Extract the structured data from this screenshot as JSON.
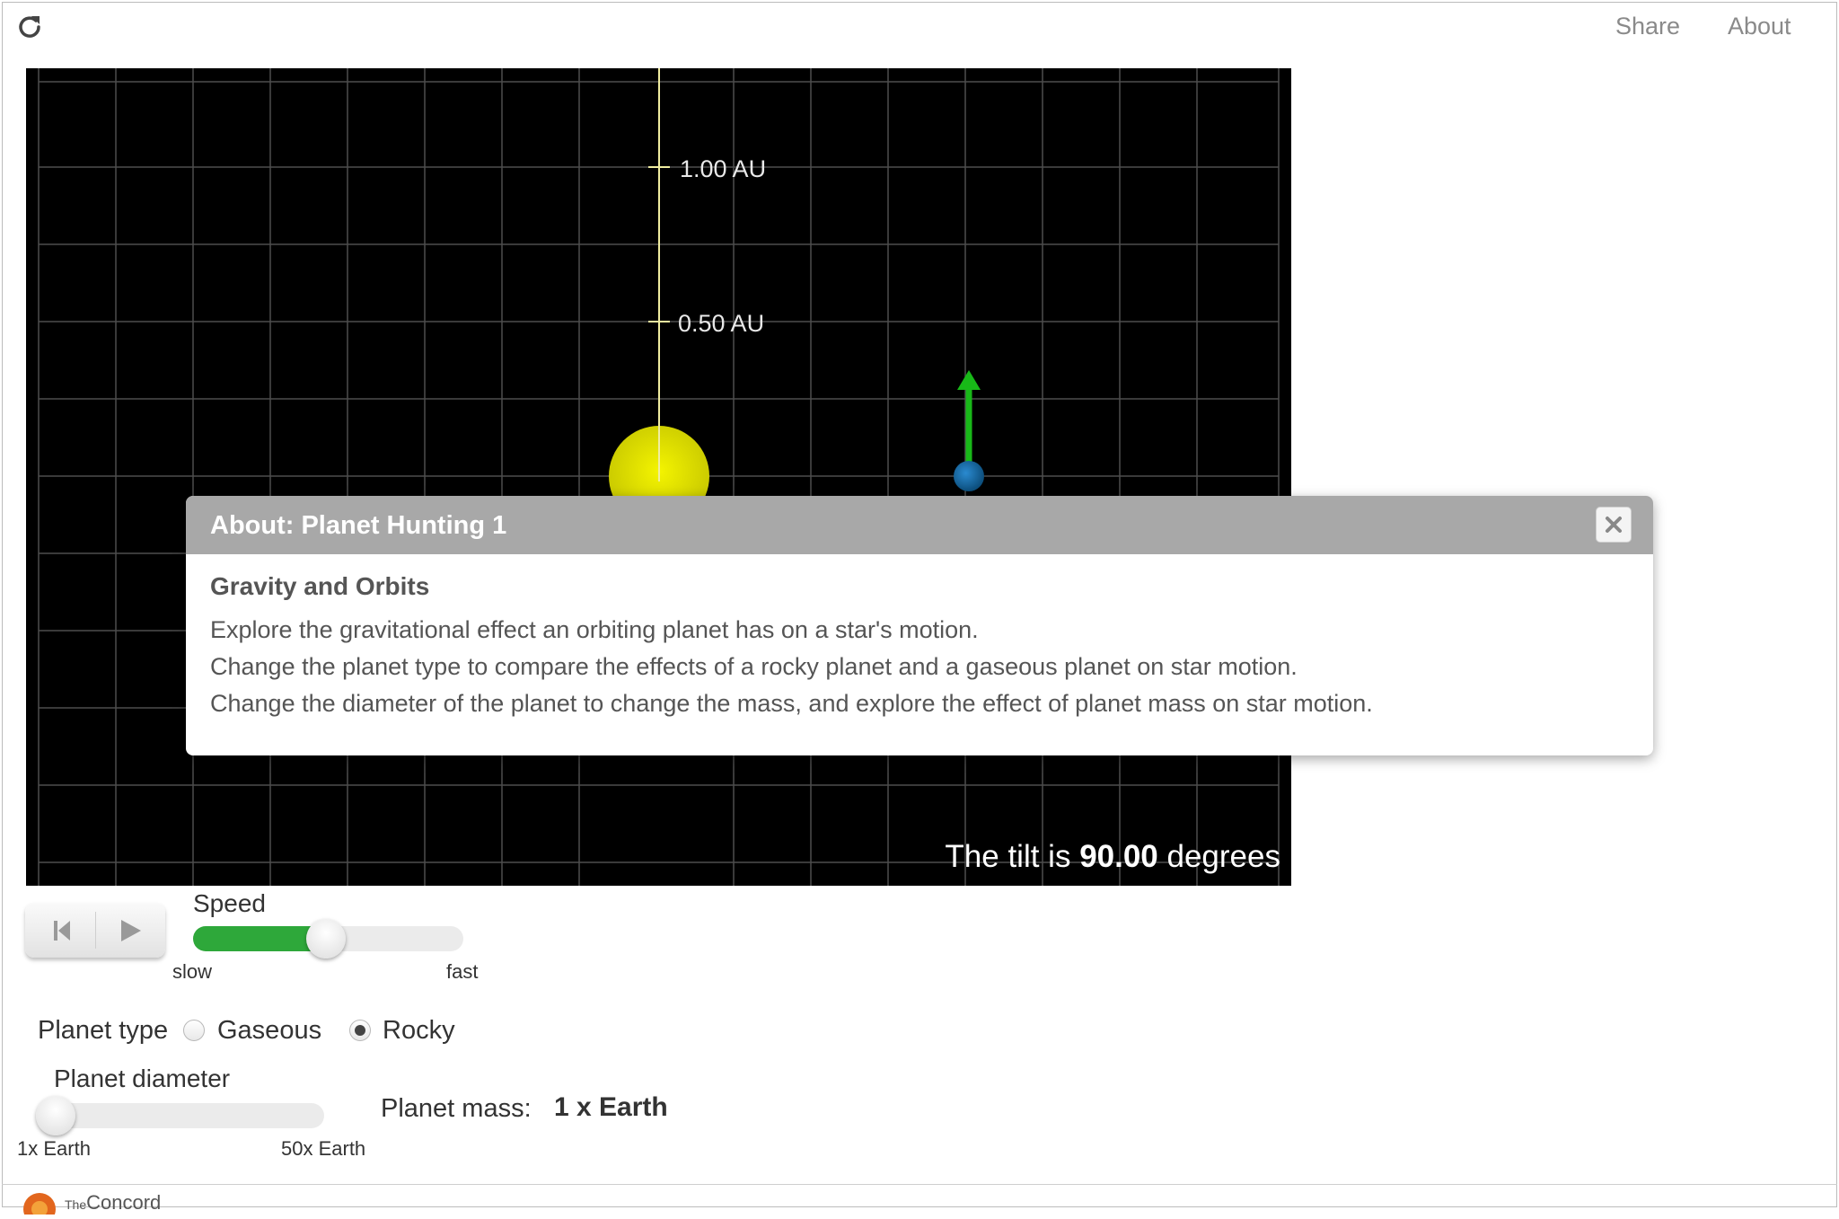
{
  "header": {
    "reload_icon": "reload-icon",
    "share_label": "Share",
    "about_label": "About"
  },
  "canvas": {
    "axis_labels": [
      "1.00 AU",
      "0.50 AU"
    ],
    "tilt_prefix": "The tilt is ",
    "tilt_value": "90.00",
    "tilt_suffix": " degrees",
    "colors": {
      "background": "#000000",
      "grid": "#5a5a5a",
      "axis": "#f3f0a8",
      "star": "#e6e600",
      "planet": "#1a6fa8",
      "velocity_arrow": "#15b815"
    }
  },
  "dialog": {
    "title": "About: Planet Hunting 1",
    "close_icon": "close-icon",
    "heading": "Gravity and Orbits",
    "lines": [
      "Explore the gravitational effect an orbiting planet has on a star's motion.",
      "Change the planet type to compare the effects of a rocky planet and a gaseous planet on star motion.",
      "Change the diameter of the planet to change the mass, and explore the effect of planet mass on star motion."
    ]
  },
  "playback": {
    "reset_icon": "reset-icon",
    "play_icon": "play-icon"
  },
  "speed": {
    "label": "Speed",
    "min_label": "slow",
    "max_label": "fast",
    "value_fraction": 0.49
  },
  "planet_type": {
    "label": "Planet type",
    "options": [
      "Gaseous",
      "Rocky"
    ],
    "selected": "Rocky"
  },
  "diameter": {
    "label": "Planet diameter",
    "min_label": "1x Earth",
    "max_label": "50x Earth",
    "value_fraction": 0
  },
  "mass": {
    "label": "Planet mass:",
    "value": "1 x Earth"
  },
  "footer": {
    "logo_small": "The",
    "logo_text": "Concord"
  }
}
